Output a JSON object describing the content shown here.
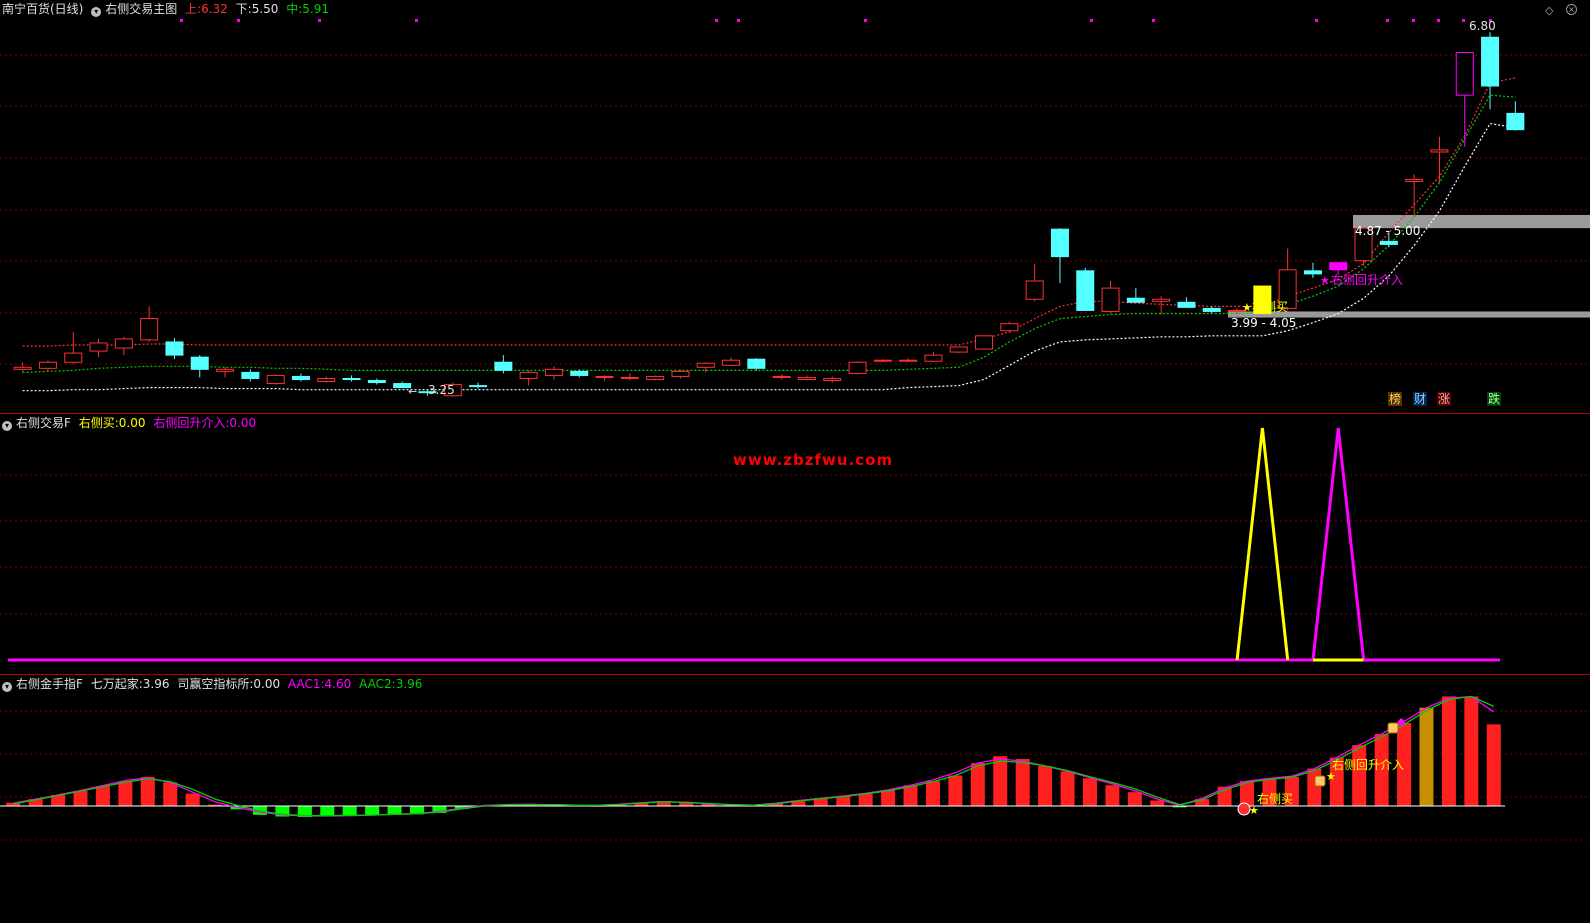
{
  "main_panel": {
    "stock_name": "南宁百货(日线)",
    "indicator_name": "右侧交易主图",
    "upper_label": "上:",
    "upper_value": "6.32",
    "lower_label": "下:",
    "lower_value": "5.50",
    "mid_label": "中:",
    "mid_value": "5.91",
    "high_label": "6.80",
    "low_label": "3.25",
    "zone_top_label": "4.87 - 5.00",
    "zone_bottom_label": "3.99 - 4.05",
    "signal_buy": "右侧买",
    "signal_pullback": "右侧回升介入",
    "news_tags": [
      "榜",
      "财",
      "涨",
      "跌"
    ],
    "colors": {
      "up": "#ff3030",
      "down": "#54ffff",
      "upper_band": "#ff3030",
      "mid_band": "#00d000",
      "lower_band": "#ffffff",
      "zone": "#9a9a9a"
    }
  },
  "osc_panel": {
    "indicator_name": "右侧交易F",
    "buy_label": "右侧买:",
    "buy_value": "0.00",
    "pullback_label": "右侧回升介入:",
    "pullback_value": "0.00",
    "watermark": "www.zbzfwu.com"
  },
  "macd_panel": {
    "indicator_name": "右侧金手指F",
    "label_a": "七万起家:",
    "value_a": "3.96",
    "label_b": "司赢空指标所:",
    "value_b": "0.00",
    "label_c": "AAC1:",
    "value_c": "4.60",
    "label_d": "AAC2:",
    "value_d": "3.96",
    "signal_buy": "右侧买",
    "signal_pullback": "右侧回升介入"
  },
  "chart_data": [
    {
      "type": "candlestick",
      "title": "南宁百货(日线)",
      "ohlc": [
        [
          3.48,
          3.55,
          3.45,
          3.5
        ],
        [
          3.49,
          3.57,
          3.46,
          3.55
        ],
        [
          3.55,
          3.85,
          3.53,
          3.64
        ],
        [
          3.66,
          3.78,
          3.6,
          3.74
        ],
        [
          3.69,
          3.8,
          3.62,
          3.78
        ],
        [
          3.77,
          4.1,
          3.75,
          3.98
        ],
        [
          3.75,
          3.79,
          3.58,
          3.62
        ],
        [
          3.6,
          3.62,
          3.4,
          3.48
        ],
        [
          3.46,
          3.5,
          3.4,
          3.48
        ],
        [
          3.45,
          3.48,
          3.36,
          3.39
        ],
        [
          3.34,
          3.43,
          3.33,
          3.42
        ],
        [
          3.41,
          3.44,
          3.36,
          3.38
        ],
        [
          3.36,
          3.41,
          3.35,
          3.39
        ],
        [
          3.39,
          3.42,
          3.36,
          3.38
        ],
        [
          3.37,
          3.39,
          3.33,
          3.35
        ],
        [
          3.34,
          3.36,
          3.3,
          3.3
        ],
        [
          3.26,
          3.28,
          3.22,
          3.25
        ],
        [
          3.22,
          3.35,
          3.21,
          3.33
        ],
        [
          3.32,
          3.35,
          3.29,
          3.31
        ],
        [
          3.55,
          3.62,
          3.44,
          3.47
        ],
        [
          3.39,
          3.47,
          3.32,
          3.45
        ],
        [
          3.42,
          3.51,
          3.38,
          3.48
        ],
        [
          3.46,
          3.48,
          3.4,
          3.42
        ],
        [
          3.4,
          3.42,
          3.37,
          3.41
        ],
        [
          3.39,
          3.44,
          3.37,
          3.4
        ],
        [
          3.38,
          3.42,
          3.37,
          3.41
        ],
        [
          3.41,
          3.48,
          3.39,
          3.46
        ],
        [
          3.5,
          3.55,
          3.45,
          3.54
        ],
        [
          3.52,
          3.6,
          3.51,
          3.57
        ],
        [
          3.58,
          3.59,
          3.47,
          3.49
        ],
        [
          3.4,
          3.43,
          3.38,
          3.41
        ],
        [
          3.38,
          3.42,
          3.37,
          3.4
        ],
        [
          3.37,
          3.41,
          3.35,
          3.39
        ],
        [
          3.44,
          3.56,
          3.43,
          3.55
        ],
        [
          3.57,
          3.58,
          3.55,
          3.57
        ],
        [
          3.57,
          3.59,
          3.55,
          3.57
        ],
        [
          3.56,
          3.65,
          3.55,
          3.62
        ],
        [
          3.65,
          3.7,
          3.64,
          3.7
        ],
        [
          3.68,
          3.82,
          3.67,
          3.81
        ],
        [
          3.86,
          3.95,
          3.84,
          3.93
        ],
        [
          4.17,
          4.52,
          4.15,
          4.35
        ],
        [
          4.86,
          4.87,
          4.33,
          4.59
        ],
        [
          4.45,
          4.48,
          4.07,
          4.06
        ],
        [
          4.05,
          4.35,
          4.03,
          4.28
        ],
        [
          4.18,
          4.28,
          4.15,
          4.14
        ],
        [
          4.15,
          4.2,
          4.02,
          4.17
        ],
        [
          4.14,
          4.19,
          4.09,
          4.09
        ],
        [
          4.08,
          4.1,
          4.03,
          4.05
        ],
        [
          4.06,
          4.08,
          4.02,
          4.06
        ],
        [
          4.3,
          4.3,
          4.26,
          4.03
        ],
        [
          4.08,
          4.67,
          4.06,
          4.46
        ],
        [
          4.45,
          4.53,
          4.38,
          4.42
        ],
        [
          4.46,
          4.53,
          4.41,
          4.53
        ],
        [
          4.55,
          4.82,
          4.5,
          4.87
        ],
        [
          4.74,
          4.83,
          4.68,
          4.71
        ],
        [
          5.33,
          5.4,
          4.98,
          5.35
        ],
        [
          5.62,
          5.77,
          5.32,
          5.64
        ],
        [
          6.18,
          6.25,
          5.67,
          6.6
        ],
        [
          6.75,
          6.8,
          6.04,
          6.27
        ],
        [
          6.0,
          6.12,
          5.83,
          5.84
        ]
      ],
      "upper_band": [
        3.71,
        3.71,
        3.72,
        3.72,
        3.72,
        3.73,
        3.73,
        3.72,
        3.72,
        3.72,
        3.72,
        3.72,
        3.72,
        3.72,
        3.72,
        3.72,
        3.72,
        3.72,
        3.72,
        3.72,
        3.72,
        3.72,
        3.72,
        3.72,
        3.72,
        3.72,
        3.72,
        3.72,
        3.72,
        3.72,
        3.72,
        3.72,
        3.72,
        3.72,
        3.72,
        3.72,
        3.72,
        3.72,
        3.78,
        3.85,
        3.98,
        4.1,
        4.15,
        4.15,
        4.13,
        4.12,
        4.11,
        4.1,
        4.1,
        4.1,
        4.2,
        4.28,
        4.37,
        4.52,
        4.83,
        5.1,
        5.38,
        5.78,
        6.3,
        6.35
      ],
      "mid_band": [
        3.45,
        3.46,
        3.47,
        3.49,
        3.5,
        3.51,
        3.51,
        3.51,
        3.5,
        3.5,
        3.49,
        3.49,
        3.48,
        3.47,
        3.47,
        3.47,
        3.47,
        3.47,
        3.47,
        3.47,
        3.47,
        3.47,
        3.47,
        3.47,
        3.47,
        3.47,
        3.47,
        3.47,
        3.47,
        3.47,
        3.47,
        3.47,
        3.47,
        3.47,
        3.47,
        3.48,
        3.49,
        3.5,
        3.6,
        3.75,
        3.88,
        3.98,
        4.0,
        4.02,
        4.03,
        4.03,
        4.03,
        4.03,
        4.03,
        4.04,
        4.12,
        4.2,
        4.3,
        4.47,
        4.7,
        4.98,
        5.32,
        5.75,
        6.18,
        6.16
      ],
      "lower_band": [
        3.27,
        3.27,
        3.28,
        3.28,
        3.29,
        3.3,
        3.3,
        3.3,
        3.29,
        3.29,
        3.29,
        3.28,
        3.28,
        3.28,
        3.28,
        3.28,
        3.28,
        3.28,
        3.28,
        3.28,
        3.28,
        3.28,
        3.28,
        3.28,
        3.28,
        3.28,
        3.28,
        3.28,
        3.28,
        3.28,
        3.28,
        3.28,
        3.28,
        3.28,
        3.28,
        3.3,
        3.31,
        3.32,
        3.38,
        3.52,
        3.66,
        3.75,
        3.77,
        3.78,
        3.79,
        3.8,
        3.8,
        3.81,
        3.81,
        3.81,
        3.86,
        3.94,
        4.03,
        4.18,
        4.4,
        4.7,
        5.04,
        5.48,
        5.9,
        5.86
      ],
      "ylim": [
        3.06,
        6.9
      ]
    },
    {
      "type": "line",
      "title": "右侧交易F",
      "series": [
        {
          "name": "右侧买",
          "color": "#ffff00",
          "x": [
            48,
            49,
            50
          ],
          "values": [
            0,
            1,
            0
          ]
        },
        {
          "name": "右侧回升介入",
          "color": "#ff00ff",
          "x": [
            51,
            52,
            53
          ],
          "values": [
            0,
            1,
            0
          ]
        }
      ],
      "ylim": [
        0,
        1
      ]
    },
    {
      "type": "bar",
      "title": "右侧金手指F",
      "values": [
        0.12,
        0.25,
        0.4,
        0.55,
        0.72,
        0.9,
        1.05,
        0.85,
        0.45,
        0.05,
        -0.12,
        -0.32,
        -0.38,
        -0.4,
        -0.38,
        -0.36,
        -0.34,
        -0.32,
        -0.3,
        -0.25,
        -0.1,
        0.02,
        0.05,
        0.06,
        0.05,
        0.03,
        0.01,
        0.05,
        0.12,
        0.18,
        0.15,
        0.08,
        0.04,
        0.02,
        0.1,
        0.2,
        0.28,
        0.35,
        0.45,
        0.58,
        0.75,
        0.9,
        1.1,
        1.55,
        1.8,
        1.7,
        1.45,
        1.25,
        1.0,
        0.75,
        0.5,
        0.2,
        -0.05,
        0.25,
        0.7,
        0.9,
        0.98,
        1.05,
        1.35,
        1.75,
        2.2,
        2.6,
        3.0,
        3.55,
        3.96,
        3.96,
        2.95
      ],
      "aac1": [
        0.1,
        0.25,
        0.4,
        0.56,
        0.74,
        0.92,
        1.02,
        0.85,
        0.5,
        0.15,
        -0.05,
        -0.22,
        -0.32,
        -0.36,
        -0.36,
        -0.35,
        -0.33,
        -0.3,
        -0.27,
        -0.2,
        -0.08,
        0.02,
        0.05,
        0.06,
        0.05,
        0.03,
        0.02,
        0.06,
        0.12,
        0.16,
        0.13,
        0.08,
        0.04,
        0.03,
        0.1,
        0.2,
        0.28,
        0.36,
        0.46,
        0.58,
        0.75,
        0.95,
        1.2,
        1.55,
        1.7,
        1.62,
        1.45,
        1.25,
        1.02,
        0.8,
        0.55,
        0.25,
        0.02,
        0.28,
        0.65,
        0.9,
        1.0,
        1.08,
        1.35,
        1.75,
        2.2,
        2.6,
        3.05,
        3.55,
        3.9,
        3.95,
        3.4
      ],
      "aac2": [
        0.08,
        0.22,
        0.38,
        0.54,
        0.7,
        0.86,
        0.98,
        0.88,
        0.6,
        0.25,
        0.02,
        -0.18,
        -0.3,
        -0.35,
        -0.35,
        -0.34,
        -0.33,
        -0.3,
        -0.28,
        -0.22,
        -0.1,
        0.0,
        0.04,
        0.05,
        0.05,
        0.03,
        0.02,
        0.05,
        0.11,
        0.15,
        0.13,
        0.09,
        0.05,
        0.03,
        0.08,
        0.18,
        0.26,
        0.34,
        0.44,
        0.55,
        0.7,
        0.88,
        1.1,
        1.45,
        1.62,
        1.58,
        1.45,
        1.28,
        1.06,
        0.85,
        0.62,
        0.32,
        0.05,
        0.22,
        0.58,
        0.85,
        0.96,
        1.04,
        1.28,
        1.66,
        2.1,
        2.5,
        2.95,
        3.45,
        3.85,
        3.96,
        3.6
      ],
      "ylim": [
        -1.6,
        4.4
      ]
    }
  ]
}
